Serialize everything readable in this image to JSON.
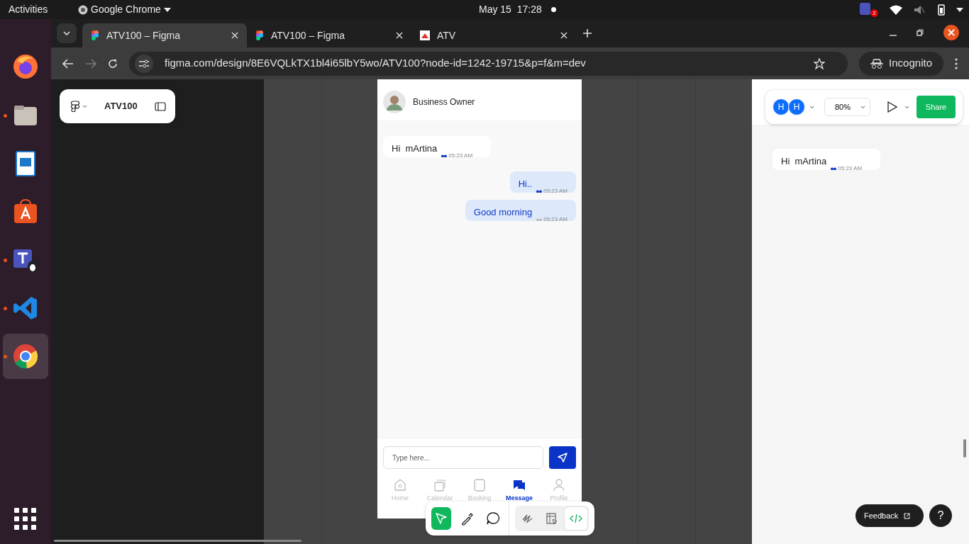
{
  "top_bar": {
    "activities": "Activities",
    "app": "Google Chrome",
    "clock": "May 15  17:28",
    "tray_badge": "2"
  },
  "dock": [
    {
      "kind": "firefox",
      "running": false,
      "selected": false
    },
    {
      "kind": "files",
      "running": true,
      "selected": false
    },
    {
      "kind": "writer",
      "running": false,
      "selected": false
    },
    {
      "kind": "store",
      "running": false,
      "selected": false
    },
    {
      "kind": "teams",
      "running": true,
      "selected": false
    },
    {
      "kind": "vscode",
      "running": true,
      "selected": false
    },
    {
      "kind": "chrome",
      "running": true,
      "selected": true
    }
  ],
  "browser": {
    "tabs": [
      {
        "title": "ATV100 – Figma",
        "kind": "figma",
        "selected": true
      },
      {
        "title": "ATV100 – Figma",
        "kind": "figma",
        "selected": false
      },
      {
        "title": "ATV",
        "kind": "site",
        "selected": false
      }
    ],
    "url": "figma.com/design/8E6VQLkTX1bl4i65lbY5wo/ATV100?node-id=1242-19715&p=f&m=dev",
    "incognito": "Incognito"
  },
  "figma": {
    "file_name": "ATV100",
    "avatars": [
      "H",
      "H"
    ],
    "zoom": "80%",
    "share": "Share",
    "feedback": "Feedback",
    "help": "?"
  },
  "chat": {
    "contact": "Business Owner",
    "messages": [
      {
        "text": "Hi  mArtina",
        "time": "05:23 AM",
        "kind": "incoming",
        "read": true
      },
      {
        "text": "Hi..",
        "time": "05:23 AM",
        "kind": "outgoing",
        "read": true
      },
      {
        "text": "Good morning",
        "time": "05:23 AM",
        "kind": "outgoing",
        "read": false
      }
    ],
    "placeholder": "Type here...",
    "nav": [
      {
        "label": "Home",
        "kind": "home",
        "selected": false
      },
      {
        "label": "Calendar",
        "kind": "calendar",
        "selected": false
      },
      {
        "label": "Booking",
        "kind": "booking",
        "selected": false
      },
      {
        "label": "Message",
        "kind": "message",
        "selected": true
      },
      {
        "label": "Profile",
        "kind": "profile",
        "selected": false
      }
    ]
  },
  "preview": {
    "messages": [
      {
        "text": "Hi  mArtina",
        "time": "05:23 AM",
        "read": true
      }
    ]
  },
  "tools": [
    {
      "kind": "pointer",
      "selected": true
    },
    {
      "kind": "pen",
      "selected": false
    },
    {
      "kind": "comment",
      "selected": false
    }
  ],
  "modes": [
    {
      "kind": "draw",
      "selected": false
    },
    {
      "kind": "design",
      "selected": false
    },
    {
      "kind": "dev",
      "selected": true
    }
  ]
}
